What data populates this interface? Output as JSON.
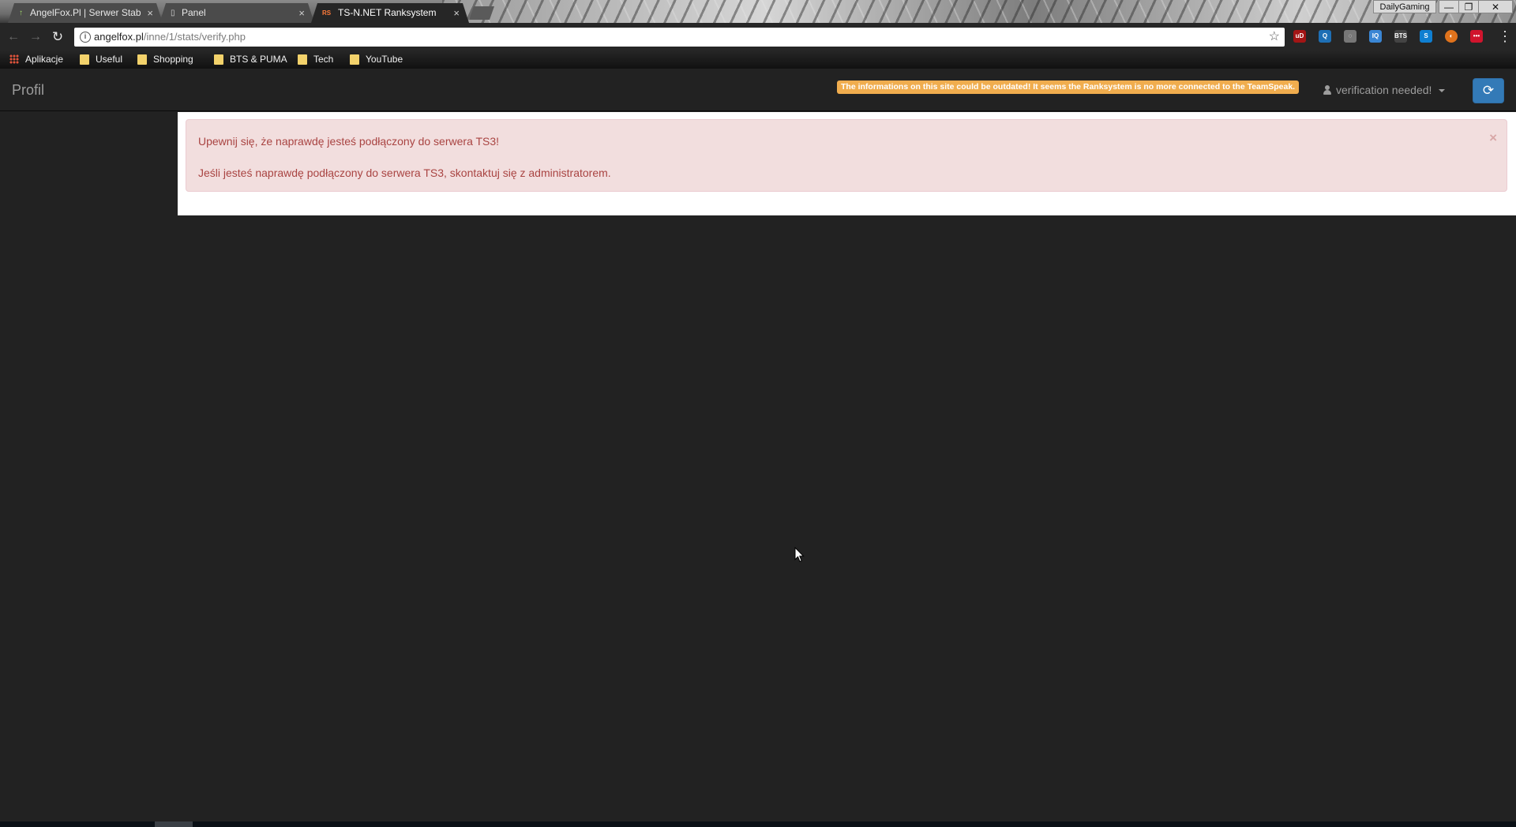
{
  "browser": {
    "tabs": [
      {
        "label": "AngelFox.Pl | Serwer Stab",
        "icon": "arrow-up-icon",
        "active": false
      },
      {
        "label": "Panel",
        "icon": "page-icon",
        "active": false
      },
      {
        "label": "TS-N.NET Ranksystem",
        "icon": "rs-logo-icon",
        "active": true
      }
    ],
    "tab_close": "×",
    "profile_name": "DailyGaming",
    "window_controls": {
      "minimize": "—",
      "restore": "❐",
      "close": "✕"
    },
    "nav": {
      "back": "←",
      "forward": "→",
      "reload": "↻"
    },
    "url": {
      "host": "angelfox.pl",
      "path": "/inne/1/stats/verify.php"
    },
    "extensions": [
      {
        "name": "ublock-icon",
        "text": "uD",
        "color": "#a31515"
      },
      {
        "name": "badge-ext-icon",
        "text": "Q",
        "color": "#1e6fb5"
      },
      {
        "name": "bulb-icon",
        "text": "◌",
        "color": "#777777"
      },
      {
        "name": "iq-icon",
        "text": "IQ",
        "color": "#3a86d4"
      },
      {
        "name": "bts-icon",
        "text": "BTS",
        "color": "#444444"
      },
      {
        "name": "skype-icon",
        "text": "S",
        "color": "#0f7fd1"
      },
      {
        "name": "orange-ext-icon",
        "text": "◐",
        "color": "#e0731c"
      },
      {
        "name": "red-ext-icon",
        "text": "•••",
        "color": "#d0142d"
      }
    ],
    "bookmarks": [
      {
        "label": "Aplikacje",
        "type": "apps"
      },
      {
        "label": "Useful",
        "type": "folder"
      },
      {
        "label": "Shopping",
        "type": "folder"
      },
      {
        "label": "BTS & PUMA",
        "type": "folder"
      },
      {
        "label": "Tech",
        "type": "folder"
      },
      {
        "label": "YouTube",
        "type": "folder"
      }
    ]
  },
  "page": {
    "brand": "Profil",
    "outdated_notice": "The informations on this site could be outdated! It seems the Ranksystem is no more connected to the TeamSpeak.",
    "user_menu_label": "verification needed!",
    "refresh_icon": "⟳",
    "alert": {
      "line1": "Upewnij się, że naprawdę jesteś podłączony do serwera TS3!",
      "line2": "Jeśli jesteś naprawdę podłączony do serwera TS3, skontaktuj się z administratorem.",
      "close": "×"
    },
    "colors": {
      "background": "#222222",
      "alert_bg": "#f2dede",
      "alert_text": "#a94442",
      "warning_badge": "#f0ad4e",
      "primary_button": "#337ab7"
    }
  }
}
